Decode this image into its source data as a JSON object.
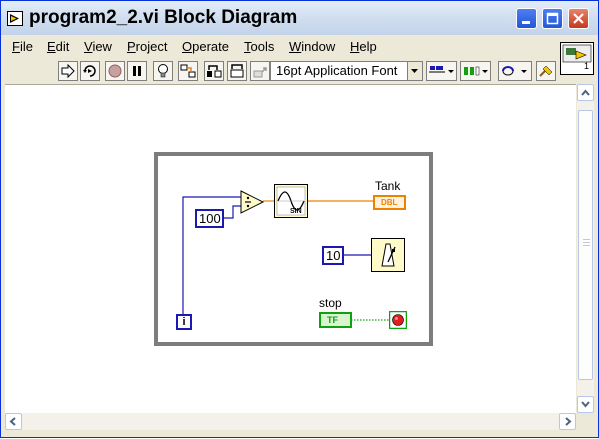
{
  "window": {
    "title": "program2_2.vi Block Diagram"
  },
  "menu": {
    "items": [
      {
        "label": "File",
        "key": "F",
        "rest": "ile"
      },
      {
        "label": "Edit",
        "key": "E",
        "rest": "dit"
      },
      {
        "label": "View",
        "key": "V",
        "rest": "iew"
      },
      {
        "label": "Project",
        "key": "P",
        "rest": "roject"
      },
      {
        "label": "Operate",
        "key": "O",
        "rest": "perate"
      },
      {
        "label": "Tools",
        "key": "T",
        "rest": "ools"
      },
      {
        "label": "Window",
        "key": "W",
        "rest": "indow"
      },
      {
        "label": "Help",
        "key": "H",
        "rest": "elp"
      }
    ]
  },
  "toolbar": {
    "font_selector": "16pt Application Font",
    "icons": [
      "run-arrow-icon",
      "run-continuously-icon",
      "abort-icon",
      "pause-icon",
      "highlight-execution-icon",
      "retain-wire-values-icon",
      "step-into-icon",
      "step-over-icon",
      "step-out-icon",
      "text-settings-icon",
      "align-icon",
      "distribute-icon",
      "reorder-icon",
      "cleanup-icon"
    ]
  },
  "vi_icon": {
    "label": "1"
  },
  "diagram": {
    "const_100": "100",
    "const_10": "10",
    "tank_label": "Tank",
    "tank_terminal": "DBL",
    "stop_label": "stop",
    "stop_terminal": "TF",
    "iteration_label": "i",
    "sine_label": "SIN"
  },
  "colors": {
    "wire_numeric": "#f08000",
    "wire_integer": "#1a1ab0",
    "wire_boolean": "#10a010",
    "loop_border": "#7d7d7d",
    "titlebar_close": "#c2391f"
  }
}
